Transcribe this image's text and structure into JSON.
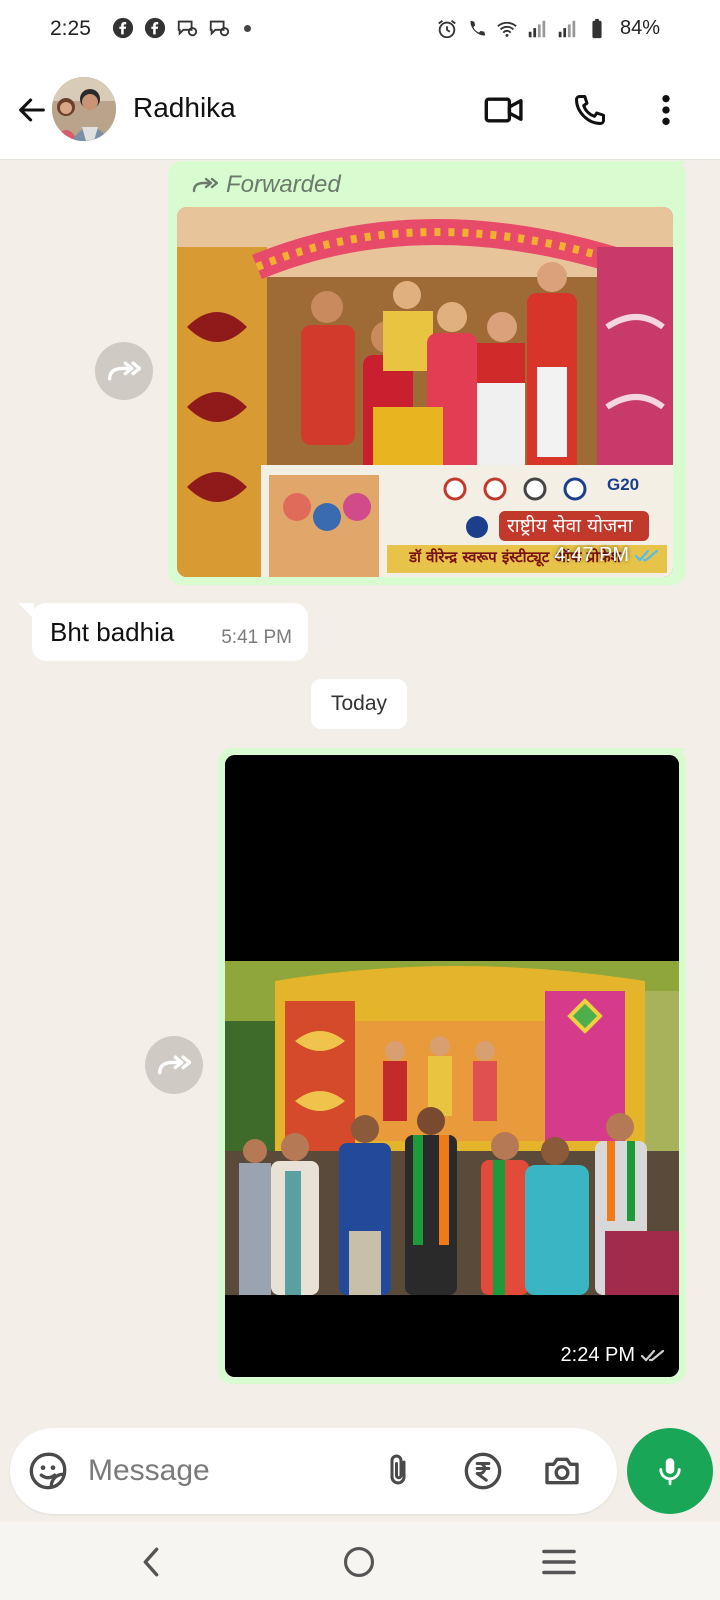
{
  "status_bar": {
    "time": "2:25",
    "battery": "84%"
  },
  "header": {
    "contact_name": "Radhika"
  },
  "messages": [
    {
      "type": "image",
      "direction": "outgoing",
      "forwarded_label": "Forwarded",
      "time": "4:47 PM",
      "image_text": {
        "banner_line1": "राष्ट्रीय सेवा योजना",
        "banner_line2": "डॉ वीरेन्द्र स्वरूप इंस्टीट्यूट ऑफ प्रोफेश",
        "logo": "G20"
      }
    },
    {
      "type": "text",
      "direction": "incoming",
      "text": "Bht badhia",
      "time": "5:41 PM"
    },
    {
      "type": "image",
      "direction": "outgoing",
      "time": "2:24 PM"
    }
  ],
  "date_separator": "Today",
  "composer": {
    "placeholder": "Message"
  },
  "colors": {
    "chat_bg": "#f3efe8",
    "outgoing_bubble": "#d8fbcf",
    "mic_button": "#1aa657"
  }
}
